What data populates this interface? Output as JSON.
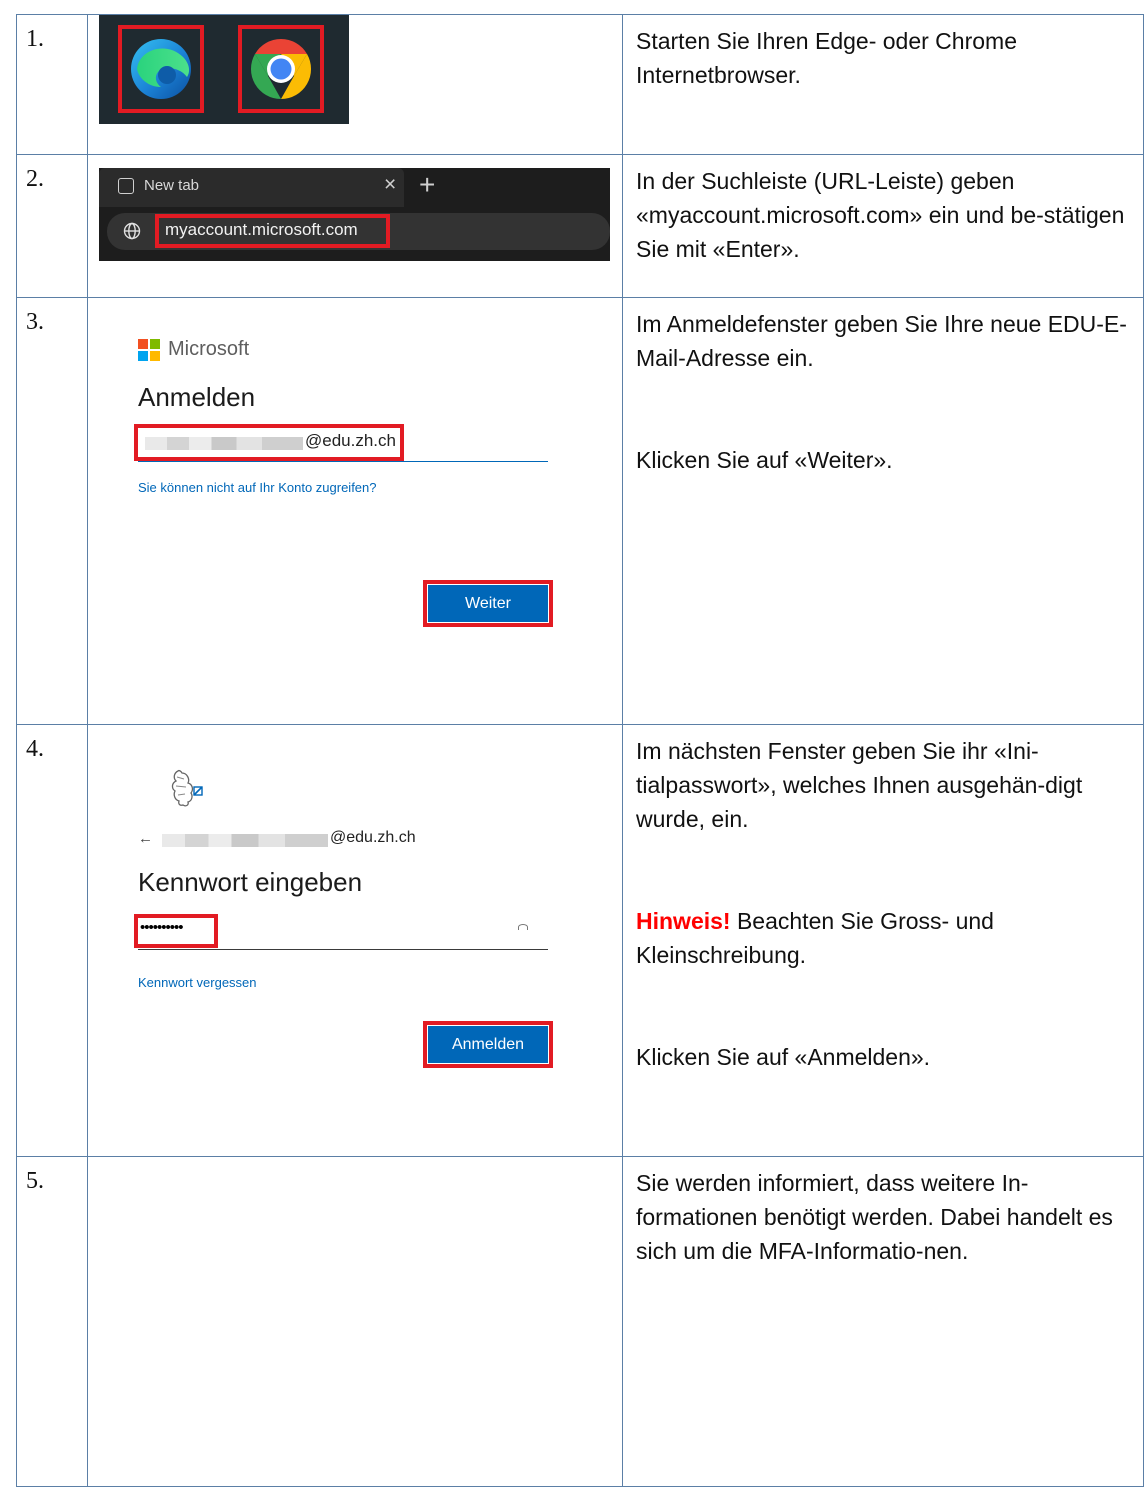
{
  "steps": [
    {
      "num": "1.",
      "desc": "Starten Sie Ihren Edge- oder Chrome Internetbrowser."
    },
    {
      "num": "2.",
      "desc": "In der Suchleiste (URL-Leiste) geben «myaccount.microsoft.com» ein und be-stätigen Sie mit «Enter»."
    },
    {
      "num": "3.",
      "desc1": "Im Anmeldefenster geben Sie Ihre neue EDU-E-Mail-Adresse ein.",
      "desc2": "Klicken Sie auf «Weiter»."
    },
    {
      "num": "4.",
      "desc1": "Im nächsten Fenster geben Sie ihr «Ini-tialpasswort», welches Ihnen ausgehän-digt wurde, ein.",
      "hint_label": "Hinweis!",
      "hint_text": " Beachten Sie Gross- und Kleinschreibung.",
      "desc3": "Klicken Sie auf «Anmelden»."
    },
    {
      "num": "5.",
      "desc": "Sie werden informiert, dass weitere In-formationen benötigt werden. Dabei handelt es sich um die MFA-Informatio-nen."
    }
  ],
  "browser_tab": {
    "title": "New tab",
    "close": "×",
    "new": "+",
    "url": "myaccount.microsoft.com"
  },
  "signin": {
    "brand": "Microsoft",
    "heading": "Anmelden",
    "email_domain": "@edu.zh.ch",
    "link": "Sie können nicht auf Ihr Konto zugreifen?",
    "button": "Weiter"
  },
  "password": {
    "back": "←",
    "email_domain": "@edu.zh.ch",
    "heading": "Kennwort eingeben",
    "value": "••••••••••",
    "link": "Kennwort vergessen",
    "button": "Anmelden"
  },
  "colors": {
    "accent": "#0067b8",
    "highlight": "#e21b23",
    "border": "#5b7fa6",
    "hint": "#ff0000"
  }
}
